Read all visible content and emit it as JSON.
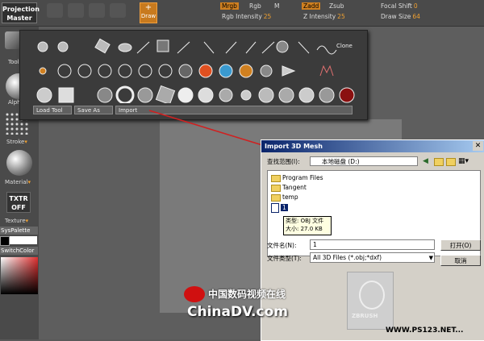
{
  "app": {
    "logo_line1": "Projection",
    "logo_line2": "Master",
    "draw_label": "Draw"
  },
  "top_fields": {
    "mrgb": "Mrgb",
    "rgb": "Rgb",
    "m": "M",
    "zadd": "Zadd",
    "zsub": "Zsub",
    "rgb_intensity_label": "Rgb Intensity",
    "rgb_intensity": "25",
    "z_intensity_label": "Z Intensity",
    "z_intensity": "25",
    "focal_shift_label": "Focal Shift",
    "focal_shift": "0",
    "draw_size_label": "Draw Size",
    "draw_size": "64"
  },
  "left_panel": {
    "tool": "Tool",
    "alpha": "Alpha",
    "stroke": "Stroke",
    "material": "Material",
    "texture": "Texture",
    "txtr_line1": "TXTR",
    "txtr_line2": "OFF",
    "syspalette": "SysPalette",
    "switchcolor": "SwitchColor"
  },
  "palette": {
    "clone": "Clone",
    "load_tool": "Load Tool",
    "save_as": "Save As",
    "import": "Import"
  },
  "dialog": {
    "title": "Import 3D Mesh",
    "lookin_label": "查找范围(I):",
    "lookin_value": "本地磁盘 (D:)",
    "files": [
      "Program Files",
      "Tangent",
      "temp"
    ],
    "selected_file": "1",
    "tooltip_type": "类型: OBJ 文件",
    "tooltip_size": "大小: 27.0 KB",
    "filename_label": "文件名(N):",
    "filename_value": "1",
    "filetype_label": "文件类型(T):",
    "filetype_value": "All 3D Files (*.obj;*dxf)",
    "open_button": "打开(O)",
    "cancel_button": "取消",
    "preview_brand": "ZBRUSH"
  },
  "watermarks": {
    "cn_site": "中国数码视频在线",
    "site": "ChinaDV.com",
    "ps123": "WWW.PS123.NET..."
  },
  "colors": {
    "accent_orange": "#d08020",
    "value_orange": "#f0a030",
    "dialog_bg": "#d4d0c8",
    "title_blue": "#0a246a",
    "arrow_red": "#d02020"
  }
}
